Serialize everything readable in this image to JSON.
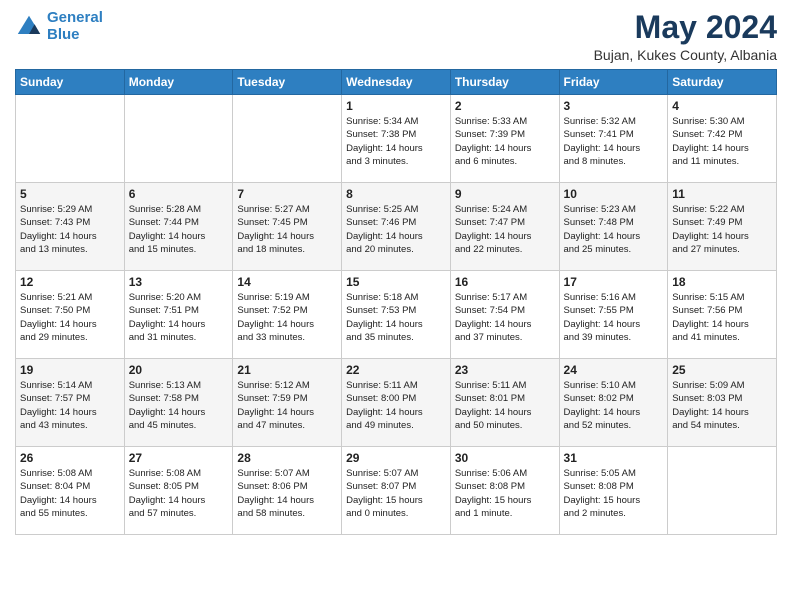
{
  "header": {
    "logo_line1": "General",
    "logo_line2": "Blue",
    "month_year": "May 2024",
    "location": "Bujan, Kukes County, Albania"
  },
  "weekdays": [
    "Sunday",
    "Monday",
    "Tuesday",
    "Wednesday",
    "Thursday",
    "Friday",
    "Saturday"
  ],
  "weeks": [
    [
      {
        "day": "",
        "info": ""
      },
      {
        "day": "",
        "info": ""
      },
      {
        "day": "",
        "info": ""
      },
      {
        "day": "1",
        "info": "Sunrise: 5:34 AM\nSunset: 7:38 PM\nDaylight: 14 hours\nand 3 minutes."
      },
      {
        "day": "2",
        "info": "Sunrise: 5:33 AM\nSunset: 7:39 PM\nDaylight: 14 hours\nand 6 minutes."
      },
      {
        "day": "3",
        "info": "Sunrise: 5:32 AM\nSunset: 7:41 PM\nDaylight: 14 hours\nand 8 minutes."
      },
      {
        "day": "4",
        "info": "Sunrise: 5:30 AM\nSunset: 7:42 PM\nDaylight: 14 hours\nand 11 minutes."
      }
    ],
    [
      {
        "day": "5",
        "info": "Sunrise: 5:29 AM\nSunset: 7:43 PM\nDaylight: 14 hours\nand 13 minutes."
      },
      {
        "day": "6",
        "info": "Sunrise: 5:28 AM\nSunset: 7:44 PM\nDaylight: 14 hours\nand 15 minutes."
      },
      {
        "day": "7",
        "info": "Sunrise: 5:27 AM\nSunset: 7:45 PM\nDaylight: 14 hours\nand 18 minutes."
      },
      {
        "day": "8",
        "info": "Sunrise: 5:25 AM\nSunset: 7:46 PM\nDaylight: 14 hours\nand 20 minutes."
      },
      {
        "day": "9",
        "info": "Sunrise: 5:24 AM\nSunset: 7:47 PM\nDaylight: 14 hours\nand 22 minutes."
      },
      {
        "day": "10",
        "info": "Sunrise: 5:23 AM\nSunset: 7:48 PM\nDaylight: 14 hours\nand 25 minutes."
      },
      {
        "day": "11",
        "info": "Sunrise: 5:22 AM\nSunset: 7:49 PM\nDaylight: 14 hours\nand 27 minutes."
      }
    ],
    [
      {
        "day": "12",
        "info": "Sunrise: 5:21 AM\nSunset: 7:50 PM\nDaylight: 14 hours\nand 29 minutes."
      },
      {
        "day": "13",
        "info": "Sunrise: 5:20 AM\nSunset: 7:51 PM\nDaylight: 14 hours\nand 31 minutes."
      },
      {
        "day": "14",
        "info": "Sunrise: 5:19 AM\nSunset: 7:52 PM\nDaylight: 14 hours\nand 33 minutes."
      },
      {
        "day": "15",
        "info": "Sunrise: 5:18 AM\nSunset: 7:53 PM\nDaylight: 14 hours\nand 35 minutes."
      },
      {
        "day": "16",
        "info": "Sunrise: 5:17 AM\nSunset: 7:54 PM\nDaylight: 14 hours\nand 37 minutes."
      },
      {
        "day": "17",
        "info": "Sunrise: 5:16 AM\nSunset: 7:55 PM\nDaylight: 14 hours\nand 39 minutes."
      },
      {
        "day": "18",
        "info": "Sunrise: 5:15 AM\nSunset: 7:56 PM\nDaylight: 14 hours\nand 41 minutes."
      }
    ],
    [
      {
        "day": "19",
        "info": "Sunrise: 5:14 AM\nSunset: 7:57 PM\nDaylight: 14 hours\nand 43 minutes."
      },
      {
        "day": "20",
        "info": "Sunrise: 5:13 AM\nSunset: 7:58 PM\nDaylight: 14 hours\nand 45 minutes."
      },
      {
        "day": "21",
        "info": "Sunrise: 5:12 AM\nSunset: 7:59 PM\nDaylight: 14 hours\nand 47 minutes."
      },
      {
        "day": "22",
        "info": "Sunrise: 5:11 AM\nSunset: 8:00 PM\nDaylight: 14 hours\nand 49 minutes."
      },
      {
        "day": "23",
        "info": "Sunrise: 5:11 AM\nSunset: 8:01 PM\nDaylight: 14 hours\nand 50 minutes."
      },
      {
        "day": "24",
        "info": "Sunrise: 5:10 AM\nSunset: 8:02 PM\nDaylight: 14 hours\nand 52 minutes."
      },
      {
        "day": "25",
        "info": "Sunrise: 5:09 AM\nSunset: 8:03 PM\nDaylight: 14 hours\nand 54 minutes."
      }
    ],
    [
      {
        "day": "26",
        "info": "Sunrise: 5:08 AM\nSunset: 8:04 PM\nDaylight: 14 hours\nand 55 minutes."
      },
      {
        "day": "27",
        "info": "Sunrise: 5:08 AM\nSunset: 8:05 PM\nDaylight: 14 hours\nand 57 minutes."
      },
      {
        "day": "28",
        "info": "Sunrise: 5:07 AM\nSunset: 8:06 PM\nDaylight: 14 hours\nand 58 minutes."
      },
      {
        "day": "29",
        "info": "Sunrise: 5:07 AM\nSunset: 8:07 PM\nDaylight: 15 hours\nand 0 minutes."
      },
      {
        "day": "30",
        "info": "Sunrise: 5:06 AM\nSunset: 8:08 PM\nDaylight: 15 hours\nand 1 minute."
      },
      {
        "day": "31",
        "info": "Sunrise: 5:05 AM\nSunset: 8:08 PM\nDaylight: 15 hours\nand 2 minutes."
      },
      {
        "day": "",
        "info": ""
      }
    ]
  ]
}
